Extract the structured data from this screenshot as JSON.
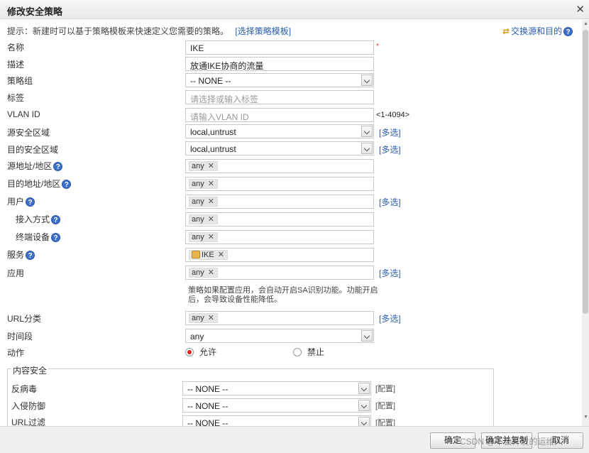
{
  "dialog": {
    "title": "修改安全策略",
    "close_icon": "close-icon"
  },
  "hint": {
    "text": "提示：新建时可以基于策略模板来快速定义您需要的策略。",
    "template_link": "[选择策略模板]"
  },
  "swap": {
    "label": "交换源和目的",
    "help": "?"
  },
  "help_mark": "?",
  "multi_select": "[多选]",
  "config_link": "[配置]",
  "required_mark": "*",
  "fields": {
    "name": {
      "label": "名称",
      "value": "IKE"
    },
    "description": {
      "label": "描述",
      "value": "放通IKE协商的流量"
    },
    "policy_group": {
      "label": "策略组",
      "value": "-- NONE --"
    },
    "tag": {
      "label": "标签",
      "placeholder": "请选择或输入标签"
    },
    "vlan_id": {
      "label": "VLAN ID",
      "placeholder": "请输入VLAN ID",
      "range": "<1-4094>"
    },
    "src_zone": {
      "label": "源安全区域",
      "value": "local,untrust"
    },
    "dst_zone": {
      "label": "目的安全区域",
      "value": "local,untrust"
    },
    "src_addr": {
      "label": "源地址/地区",
      "chip": "any"
    },
    "dst_addr": {
      "label": "目的地址/地区",
      "chip": "any"
    },
    "user": {
      "label": "用户",
      "chip": "any"
    },
    "access_mode": {
      "label": "接入方式",
      "chip": "any"
    },
    "terminal": {
      "label": "终端设备",
      "chip": "any"
    },
    "service": {
      "label": "服务",
      "chip": "IKE"
    },
    "application": {
      "label": "应用",
      "chip": "any",
      "note": "策略如果配置应用，会自动开启SA识别功能。功能开启后，会导致设备性能降低。"
    },
    "url_category": {
      "label": "URL分类",
      "chip": "any"
    },
    "time_range": {
      "label": "时间段",
      "value": "any"
    },
    "action": {
      "label": "动作",
      "allow": "允许",
      "deny": "禁止",
      "selected": "allow"
    }
  },
  "content_security": {
    "legend": "内容安全",
    "antivirus": {
      "label": "反病毒",
      "value": "-- NONE --"
    },
    "ips": {
      "label": "入侵防御",
      "value": "-- NONE --"
    },
    "url_filter": {
      "label": "URL过滤",
      "value": "-- NONE --"
    }
  },
  "footer": {
    "ok": "确定",
    "ok_continue": "确定并复制",
    "cancel": "取消"
  },
  "watermark": "CSDN @不会开发的运维人"
}
